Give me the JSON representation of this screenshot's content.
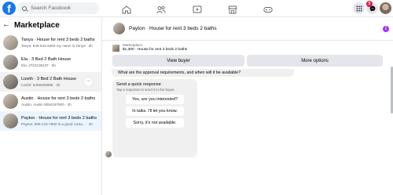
{
  "brand": {
    "logo_letter": "f"
  },
  "search": {
    "placeholder": "Search Facebook"
  },
  "notifications": {
    "count": "5"
  },
  "marketplace": {
    "back_glyph": "←",
    "title": "Marketplace",
    "more_glyph": "···",
    "conversations": [
      {
        "title": "Tanya · House for rent 3 beds 2 baths",
        "preview": "Tanya: 646-642-6460 my name is Tanya · 6h"
      },
      {
        "title": "Ela · 3 Bed 2 Bath House",
        "preview": "Ela: 2722138137 · 5h"
      },
      {
        "title": "Lizeth · 3 Bed 2 Bath House",
        "preview": "Lizeth: 5408408898 · 2h"
      },
      {
        "title": "Austin · House for rent 3 beds 2 baths",
        "preview": "Austin: Austin 6094197900 · 2h"
      },
      {
        "title": "Payton · House for rent 3 beds 2 baths",
        "preview": "Payton: 606-419-7900 is a good conta... · 2h"
      }
    ]
  },
  "chat": {
    "title": "Payton · House for rent 3 beds 2 baths",
    "info_glyph": "i",
    "listing_label": "Marketplace",
    "listing_price": "$1,300 · House for rent 3 beds 2 baths",
    "view_buyer_label": "View buyer",
    "more_options_label": "More options",
    "question": "What are the approval requirements, and when will it be available?",
    "quick_title": "Send a quick response",
    "quick_subtitle": "Tap a response to send it to the buyer.",
    "quick_responses": [
      "Yes, are you interested?",
      "In talks. I'll let you know.",
      "Sorry, it's not available."
    ]
  },
  "colors": {
    "accent": "#1877f2",
    "badge": "#e41e3f",
    "info": "#a033ff"
  },
  "icons": [
    "home-icon",
    "friends-icon",
    "watch-icon",
    "marketplace-icon",
    "gaming-icon",
    "menu-grid-icon",
    "messenger-icon",
    "bell-icon"
  ]
}
